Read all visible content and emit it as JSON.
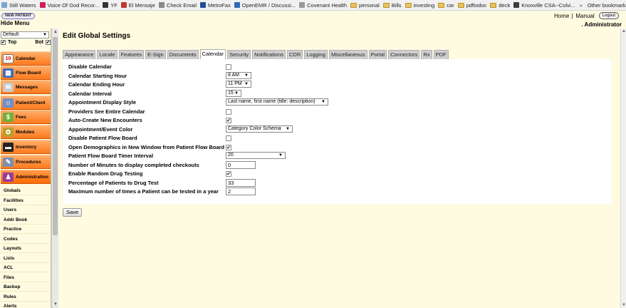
{
  "bookmarks": {
    "items": [
      {
        "label": "Still Waters",
        "icon": "page-icon",
        "color": "#7aa6d6"
      },
      {
        "label": "Voice Of God Recor...",
        "icon": "globe-icon",
        "color": "#c25"
      },
      {
        "label": "YF",
        "icon": "page-icon",
        "color": "#333"
      },
      {
        "label": "El Mensaje",
        "icon": "globe-icon",
        "color": "#c0392b"
      },
      {
        "label": "Check Email",
        "icon": "page-icon",
        "color": "#888"
      },
      {
        "label": "MetroFax",
        "icon": "fax-icon",
        "color": "#1f4e96"
      },
      {
        "label": "OpenEMR / Discussi...",
        "icon": "forum-icon",
        "color": "#2d6cb5"
      },
      {
        "label": "Covenant Health",
        "icon": "page-icon",
        "color": "#999"
      },
      {
        "label": "personal",
        "icon": "folder-icon"
      },
      {
        "label": "Bills",
        "icon": "folder-icon"
      },
      {
        "label": "investing",
        "icon": "folder-icon"
      },
      {
        "label": "car",
        "icon": "folder-icon"
      },
      {
        "label": "pdftodoc",
        "icon": "folder-icon"
      },
      {
        "label": "deck",
        "icon": "folder-icon"
      },
      {
        "label": "Knoxville CSA--Colvi...",
        "icon": "page-icon",
        "color": "#3a3a3a"
      }
    ],
    "overflow": "»",
    "other": "Other bookmarks"
  },
  "header": {
    "new_patient": "NEW PATIENT",
    "hide_menu": "Hide Menu",
    "home": "Home",
    "separator": "|",
    "manual": "Manual",
    "logout": "Logout",
    "user": ". Administrator"
  },
  "nav": {
    "select_value": "Default",
    "select_arrow": "▼",
    "top_label": "Top",
    "bot_label": "Bot",
    "checkmark": "✔",
    "menu": [
      {
        "label": "Calendar",
        "icon": "calendar-icon",
        "glyph": "10"
      },
      {
        "label": "Flow Board",
        "icon": "flow-board-icon",
        "glyph": "▦"
      },
      {
        "label": "Messages",
        "icon": "messages-icon",
        "glyph": "✉"
      },
      {
        "label": "Patient/Client",
        "icon": "patient-icon",
        "glyph": "☺"
      },
      {
        "label": "Fees",
        "icon": "fees-icon",
        "glyph": "$"
      },
      {
        "label": "Modules",
        "icon": "modules-icon",
        "glyph": "✿"
      },
      {
        "label": "Inventory",
        "icon": "inventory-icon",
        "glyph": "▬"
      },
      {
        "label": "Procedures",
        "icon": "procedures-icon",
        "glyph": "✎"
      },
      {
        "label": "Administration",
        "icon": "administration-icon",
        "glyph": "♟"
      }
    ],
    "admin_items": [
      "Globals",
      "Facilities",
      "Users",
      "Addr Book",
      "Practice",
      "Codes",
      "Layouts",
      "Lists",
      "ACL",
      "Files",
      "Backup",
      "Rules",
      "Alerts"
    ]
  },
  "main": {
    "title": "Edit Global Settings",
    "active_tab": "Calendar",
    "tabs": [
      "Appearance",
      "Locale",
      "Features",
      "E-Sign",
      "Documents",
      "Calendar",
      "Security",
      "Notifications",
      "CDR",
      "Logging",
      "Miscellaneous",
      "Portal",
      "Connectors",
      "Rx",
      "PDF"
    ],
    "settings": [
      {
        "label": "Disable Calendar",
        "type": "checkbox",
        "checked": false
      },
      {
        "label": "Calendar Starting Hour",
        "type": "select",
        "value": "8 AM"
      },
      {
        "label": "Calendar Ending Hour",
        "type": "select",
        "value": "11 PM"
      },
      {
        "label": "Calendar Interval",
        "type": "select",
        "value": "15"
      },
      {
        "label": "Appointment Display Style",
        "type": "select",
        "value": "Last name, first name (title: description)"
      },
      {
        "label": "Providers See Entire Calendar",
        "type": "checkbox",
        "checked": false
      },
      {
        "label": "Auto-Create New Encounters",
        "type": "checkbox",
        "checked": true
      },
      {
        "label": "Appointment/Event Color",
        "type": "select",
        "value": "Category Color Schema"
      },
      {
        "label": "Disable Patient Flow Board",
        "type": "checkbox",
        "checked": false
      },
      {
        "label": "Open Demographics in New Window from Patient Flow Board",
        "type": "checkbox",
        "checked": true
      },
      {
        "label": "Patient Flow Board Timer Interval",
        "type": "select",
        "value": "20"
      },
      {
        "label": "Number of Minutes to display completed checkouts",
        "type": "text",
        "value": "0"
      },
      {
        "label": "Enable Random Drug Testing",
        "type": "checkbox",
        "checked": true
      },
      {
        "label": "Percentage of Patients to Drug Test",
        "type": "text",
        "value": "33"
      },
      {
        "label": "Maximum number of times a Patient can be tested in a year",
        "type": "text",
        "value": "2"
      }
    ],
    "select_arrow": "▼",
    "checkmark": "✔",
    "save": "Save"
  },
  "scrollbar": {
    "up": "▲",
    "down": "▼"
  },
  "colors": {
    "background": "#fffbe1",
    "nav_button": "#ff8c3a",
    "tab_inactive": "#cfcfcf",
    "panel": "#ffffff"
  }
}
